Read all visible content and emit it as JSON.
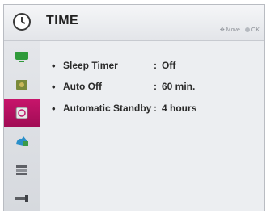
{
  "header": {
    "icon": "clock-icon",
    "title": "TIME",
    "hint_move": "Move",
    "hint_ok": "OK"
  },
  "sidebar": {
    "items": [
      {
        "icon": "picture-icon",
        "active": false
      },
      {
        "icon": "audio-icon",
        "active": false
      },
      {
        "icon": "time-icon",
        "active": true
      },
      {
        "icon": "lock-icon",
        "active": false
      },
      {
        "icon": "option-icon",
        "active": false
      },
      {
        "icon": "input-icon",
        "active": false
      }
    ]
  },
  "settings": [
    {
      "label": "Sleep Timer",
      "value": "Off"
    },
    {
      "label": "Auto Off",
      "value": "60 min."
    },
    {
      "label": "Automatic Standby",
      "value": "4 hours"
    }
  ],
  "colors": {
    "accent": "#b8105f",
    "background": "#eceef1"
  }
}
